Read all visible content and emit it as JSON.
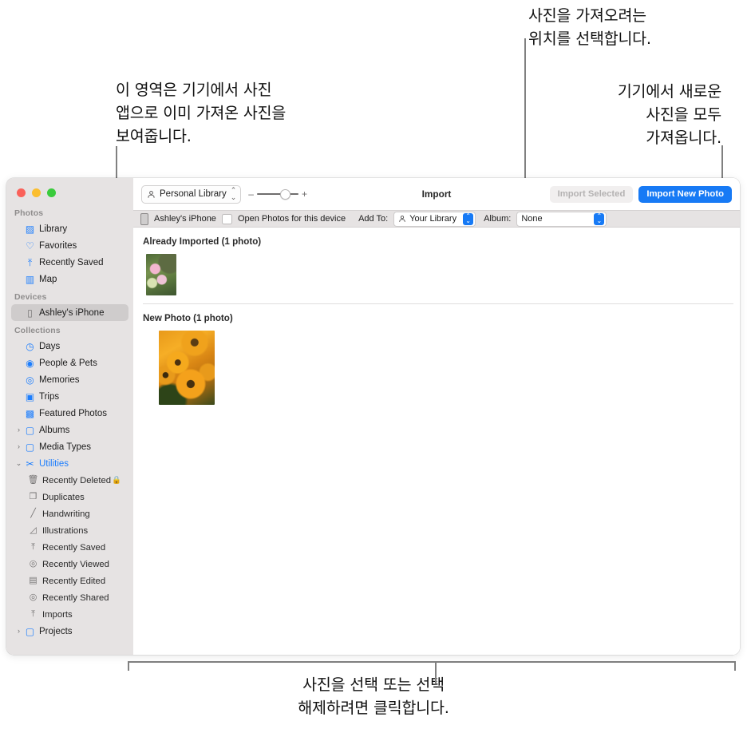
{
  "annotations": {
    "left_top": "이 영역은 기기에서 사진\n앱으로 이미 가져온 사진을\n보여줍니다.",
    "right_top": "사진을 가져오려는\n위치를 선택합니다.",
    "right_second": "기기에서 새로운\n사진을 모두\n가져옵니다.",
    "bottom": "사진을 선택 또는 선택\n해제하려면 클릭합니다."
  },
  "window": {
    "traffic_lights": [
      "close-red",
      "minimize-yellow",
      "zoom-green"
    ]
  },
  "sidebar": {
    "groups": [
      {
        "title": "Photos",
        "items": [
          {
            "label": "Library",
            "icon": "photos-library-icon",
            "icon_glyph": "▨",
            "icon_color": "#1d7efd",
            "twisty": "",
            "selected": false,
            "nested": false,
            "lock": ""
          },
          {
            "label": "Favorites",
            "icon": "heart-icon",
            "icon_glyph": "♡",
            "icon_color": "#1d7efd",
            "twisty": "",
            "selected": false,
            "nested": false,
            "lock": ""
          },
          {
            "label": "Recently Saved",
            "icon": "tray-arrow-up-icon",
            "icon_glyph": "⤒",
            "icon_color": "#1d7efd",
            "twisty": "",
            "selected": false,
            "nested": false,
            "lock": ""
          },
          {
            "label": "Map",
            "icon": "map-icon",
            "icon_glyph": "▥",
            "icon_color": "#1d7efd",
            "twisty": "",
            "selected": false,
            "nested": false,
            "lock": ""
          }
        ]
      },
      {
        "title": "Devices",
        "items": [
          {
            "label": "Ashley's iPhone",
            "icon": "iphone-icon",
            "icon_glyph": "▯",
            "icon_color": "#6c6a6a",
            "twisty": "",
            "selected": true,
            "nested": false,
            "lock": ""
          }
        ]
      },
      {
        "title": "Collections",
        "items": [
          {
            "label": "Days",
            "icon": "clock-icon",
            "icon_glyph": "◷",
            "icon_color": "#1d7efd",
            "twisty": "",
            "selected": false,
            "nested": false,
            "lock": ""
          },
          {
            "label": "People & Pets",
            "icon": "person-circle-icon",
            "icon_glyph": "◉",
            "icon_color": "#1d7efd",
            "twisty": "",
            "selected": false,
            "nested": false,
            "lock": ""
          },
          {
            "label": "Memories",
            "icon": "memories-icon",
            "icon_glyph": "◎",
            "icon_color": "#1d7efd",
            "twisty": "",
            "selected": false,
            "nested": false,
            "lock": ""
          },
          {
            "label": "Trips",
            "icon": "suitcase-icon",
            "icon_glyph": "▣",
            "icon_color": "#1d7efd",
            "twisty": "",
            "selected": false,
            "nested": false,
            "lock": ""
          },
          {
            "label": "Featured Photos",
            "icon": "photo-icon",
            "icon_glyph": "▩",
            "icon_color": "#1d7efd",
            "twisty": "",
            "selected": false,
            "nested": false,
            "lock": ""
          },
          {
            "label": "Albums",
            "icon": "folder-icon",
            "icon_glyph": "▢",
            "icon_color": "#1d7efd",
            "twisty": "›",
            "selected": false,
            "nested": false,
            "lock": ""
          },
          {
            "label": "Media Types",
            "icon": "folder-icon",
            "icon_glyph": "▢",
            "icon_color": "#1d7efd",
            "twisty": "›",
            "selected": false,
            "nested": false,
            "lock": ""
          },
          {
            "label": "Utilities",
            "icon": "tools-icon",
            "icon_glyph": "✂",
            "icon_color": "#1d7efd",
            "twisty": "⌄",
            "selected": false,
            "nested": false,
            "lock": ""
          },
          {
            "label": "Recently Deleted",
            "icon": "trash-icon",
            "icon_glyph": "🗑",
            "icon_color": "#777575",
            "twisty": "",
            "selected": false,
            "nested": true,
            "lock": "🔒"
          },
          {
            "label": "Duplicates",
            "icon": "duplicate-icon",
            "icon_glyph": "❐",
            "icon_color": "#777575",
            "twisty": "",
            "selected": false,
            "nested": true,
            "lock": ""
          },
          {
            "label": "Handwriting",
            "icon": "pen-stroke-icon",
            "icon_glyph": "╱",
            "icon_color": "#777575",
            "twisty": "",
            "selected": false,
            "nested": true,
            "lock": ""
          },
          {
            "label": "Illustrations",
            "icon": "illustration-icon",
            "icon_glyph": "◿",
            "icon_color": "#9a9898",
            "twisty": "",
            "selected": false,
            "nested": true,
            "lock": ""
          },
          {
            "label": "Recently Saved",
            "icon": "tray-arrow-up-icon",
            "icon_glyph": "⤒",
            "icon_color": "#777575",
            "twisty": "",
            "selected": false,
            "nested": true,
            "lock": ""
          },
          {
            "label": "Recently Viewed",
            "icon": "eye-circle-icon",
            "icon_glyph": "◎",
            "icon_color": "#777575",
            "twisty": "",
            "selected": false,
            "nested": true,
            "lock": ""
          },
          {
            "label": "Recently Edited",
            "icon": "sliders-icon",
            "icon_glyph": "▤",
            "icon_color": "#777575",
            "twisty": "",
            "selected": false,
            "nested": true,
            "lock": ""
          },
          {
            "label": "Recently Shared",
            "icon": "share-circle-icon",
            "icon_glyph": "◎",
            "icon_color": "#777575",
            "twisty": "",
            "selected": false,
            "nested": true,
            "lock": ""
          },
          {
            "label": "Imports",
            "icon": "tray-arrow-up-icon",
            "icon_glyph": "⤒",
            "icon_color": "#777575",
            "twisty": "",
            "selected": false,
            "nested": true,
            "lock": ""
          },
          {
            "label": "Projects",
            "icon": "folder-icon",
            "icon_glyph": "▢",
            "icon_color": "#1d7efd",
            "twisty": "›",
            "selected": false,
            "nested": false,
            "lock": ""
          }
        ]
      }
    ]
  },
  "toolbar": {
    "library_popup": "Personal Library",
    "zoom_minus": "–",
    "zoom_plus": "+",
    "title": "Import",
    "import_selected_label": "Import Selected",
    "import_new_label": "Import New Photo",
    "accent_color": "#177af5"
  },
  "importbar": {
    "device_name": "Ashley's iPhone",
    "open_photos_label": "Open Photos for this device",
    "add_to_label": "Add To:",
    "add_to_value": "Your Library",
    "album_label": "Album:",
    "album_value": "None"
  },
  "content": {
    "sections": [
      {
        "title": "Already Imported (1 photo)",
        "photo": "pink-cosmos-flowers"
      },
      {
        "title": "New Photo (1 photo)",
        "photo": "orange-rudbeckia-flowers"
      }
    ]
  }
}
